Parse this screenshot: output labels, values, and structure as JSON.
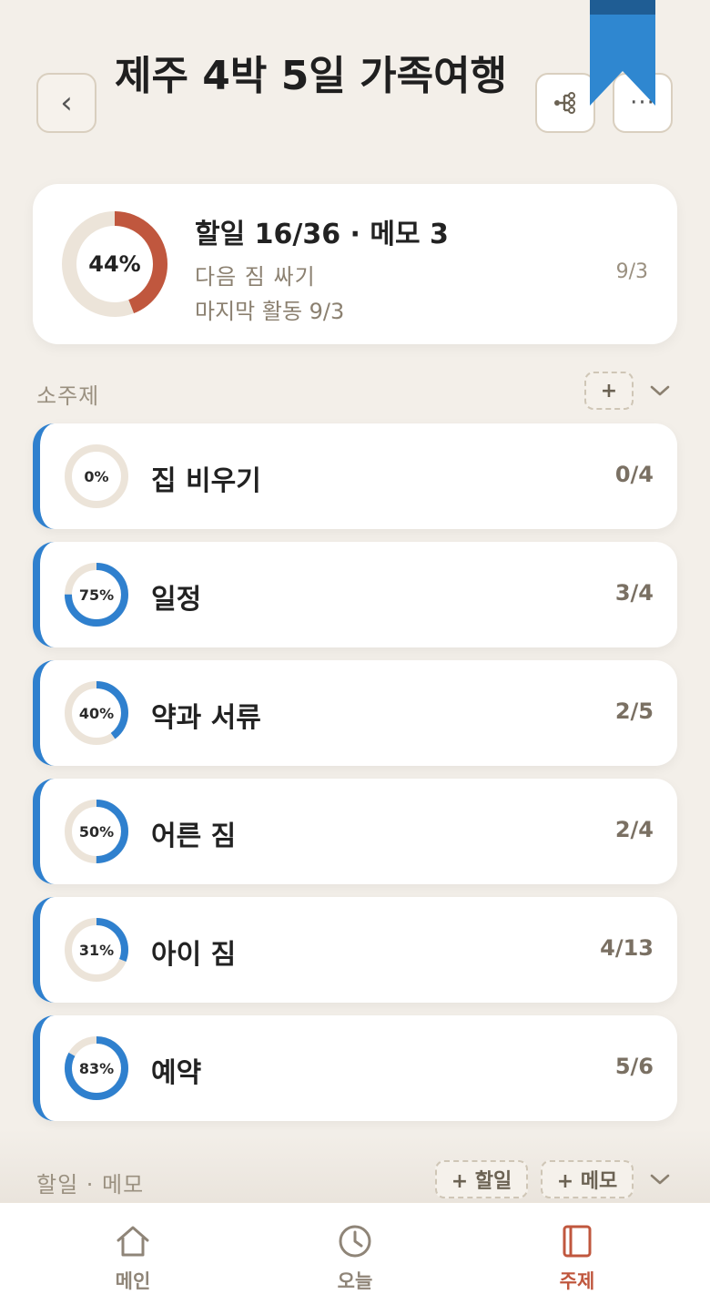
{
  "header": {
    "title": "제주 4박 5일 가족여행",
    "back_glyph": "‹",
    "more_glyph": "···"
  },
  "summary": {
    "percent_label": "44%",
    "percent_value": 0.44,
    "stats": "할일 16/36 · 메모 3",
    "next_task": "다음  짐 싸기",
    "next_date": "9/3",
    "last_activity": "마지막 활동 9/3"
  },
  "subtopics_section": {
    "label": "소주제",
    "add_label": "+"
  },
  "topics": [
    {
      "name": "집 비우기",
      "percent_label": "0%",
      "percent_value": 0.0,
      "count": "0/4"
    },
    {
      "name": "일정",
      "percent_label": "75%",
      "percent_value": 0.75,
      "count": "3/4"
    },
    {
      "name": "약과 서류",
      "percent_label": "40%",
      "percent_value": 0.4,
      "count": "2/5"
    },
    {
      "name": "어른 짐",
      "percent_label": "50%",
      "percent_value": 0.5,
      "count": "2/4"
    },
    {
      "name": "아이 짐",
      "percent_label": "31%",
      "percent_value": 0.31,
      "count": "4/13"
    },
    {
      "name": "예약",
      "percent_label": "83%",
      "percent_value": 0.83,
      "count": "5/6"
    }
  ],
  "tasks_section": {
    "label": "할일 · 메모",
    "add_task_label": "+ 할일",
    "add_memo_label": "+ 메모"
  },
  "nav": {
    "items": [
      {
        "label": "메인",
        "icon": "home-icon"
      },
      {
        "label": "오늘",
        "icon": "clock-icon"
      },
      {
        "label": "주제",
        "icon": "book-icon",
        "active": true
      }
    ]
  },
  "colors": {
    "accent_blue": "#2f80ce",
    "accent_rust": "#c0573e",
    "track": "#ece4d9",
    "bookmark": "#2f87d0",
    "bookmark_dark": "#1f5d94"
  }
}
